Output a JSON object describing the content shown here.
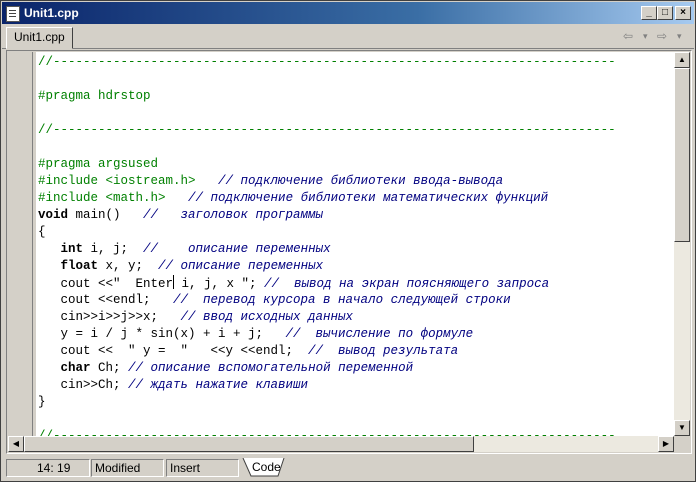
{
  "window": {
    "title": "Unit1.cpp"
  },
  "title_buttons": {
    "minimize": "_",
    "maximize": "□",
    "close": "×"
  },
  "tabs": [
    {
      "label": "Unit1.cpp"
    }
  ],
  "nav": {
    "back": "⇦",
    "back_menu": "▾",
    "forward": "⇨",
    "forward_menu": "▾"
  },
  "code_lines": [
    [
      {
        "t": "//---------------------------------------------------------------------------",
        "c": "pp"
      }
    ],
    [
      {
        "t": "",
        "c": "txt"
      }
    ],
    [
      {
        "t": "#pragma hdrstop",
        "c": "pp"
      }
    ],
    [
      {
        "t": "",
        "c": "txt"
      }
    ],
    [
      {
        "t": "//---------------------------------------------------------------------------",
        "c": "pp"
      }
    ],
    [
      {
        "t": "",
        "c": "txt"
      }
    ],
    [
      {
        "t": "#pragma argsused",
        "c": "pp"
      }
    ],
    [
      {
        "t": "#include <iostream.h>",
        "c": "pp"
      },
      {
        "t": "   ",
        "c": "txt"
      },
      {
        "t": "// подключение библиотеки ввода-вывода",
        "c": "cmt"
      }
    ],
    [
      {
        "t": "#include <math.h>",
        "c": "pp"
      },
      {
        "t": "   ",
        "c": "txt"
      },
      {
        "t": "// подключение библиотеки математических функций",
        "c": "cmt"
      }
    ],
    [
      {
        "t": "void",
        "c": "kw"
      },
      {
        "t": " main()   ",
        "c": "txt"
      },
      {
        "t": "//   заголовок программы",
        "c": "cmt"
      }
    ],
    [
      {
        "t": "{",
        "c": "txt"
      }
    ],
    [
      {
        "t": "   ",
        "c": "txt"
      },
      {
        "t": "int",
        "c": "kw"
      },
      {
        "t": " i, j;  ",
        "c": "txt"
      },
      {
        "t": "//    описание переменных",
        "c": "cmt"
      }
    ],
    [
      {
        "t": "   ",
        "c": "txt"
      },
      {
        "t": "float",
        "c": "kw"
      },
      {
        "t": " x, y;  ",
        "c": "txt"
      },
      {
        "t": "// описание переменных",
        "c": "cmt"
      }
    ],
    [
      {
        "t": "   cout <<\"  Enter",
        "c": "txt"
      },
      {
        "t": "",
        "c": "caret"
      },
      {
        "t": " i, j, x \"; ",
        "c": "txt"
      },
      {
        "t": "//  вывод на экран поясняющего запроса",
        "c": "cmt"
      }
    ],
    [
      {
        "t": "   cout <<endl;   ",
        "c": "txt"
      },
      {
        "t": "//  перевод курсора в начало следующей строки",
        "c": "cmt"
      }
    ],
    [
      {
        "t": "   cin>>i>>j>>x;   ",
        "c": "txt"
      },
      {
        "t": "// ввод исходных данных",
        "c": "cmt"
      }
    ],
    [
      {
        "t": "   y = i / j * sin(x) + i + j;   ",
        "c": "txt"
      },
      {
        "t": "//  вычисление по формуле",
        "c": "cmt"
      }
    ],
    [
      {
        "t": "   cout <<  \" y =  \"   <<y <<endl;  ",
        "c": "txt"
      },
      {
        "t": "//  вывод результата",
        "c": "cmt"
      }
    ],
    [
      {
        "t": "   ",
        "c": "txt"
      },
      {
        "t": "char",
        "c": "kw"
      },
      {
        "t": " Ch; ",
        "c": "txt"
      },
      {
        "t": "// описание вспомогательной переменной",
        "c": "cmt"
      }
    ],
    [
      {
        "t": "   cin>>Ch; ",
        "c": "txt"
      },
      {
        "t": "// ждать нажатие клавиши",
        "c": "cmt"
      }
    ],
    [
      {
        "t": "}",
        "c": "txt"
      }
    ],
    [
      {
        "t": "",
        "c": "txt"
      }
    ],
    [
      {
        "t": "//---------------------------------------------------------------------------",
        "c": "pp"
      }
    ]
  ],
  "scroll_arrows": {
    "up": "▲",
    "down": "▼",
    "left": "◀",
    "right": "▶"
  },
  "status": {
    "position": "14: 19",
    "modified": "Modified",
    "mode": "Insert",
    "view_tab": "Code"
  },
  "colors": {
    "preprocessor": "#008000",
    "comment": "#000080",
    "titlebar": "#0a246a"
  }
}
